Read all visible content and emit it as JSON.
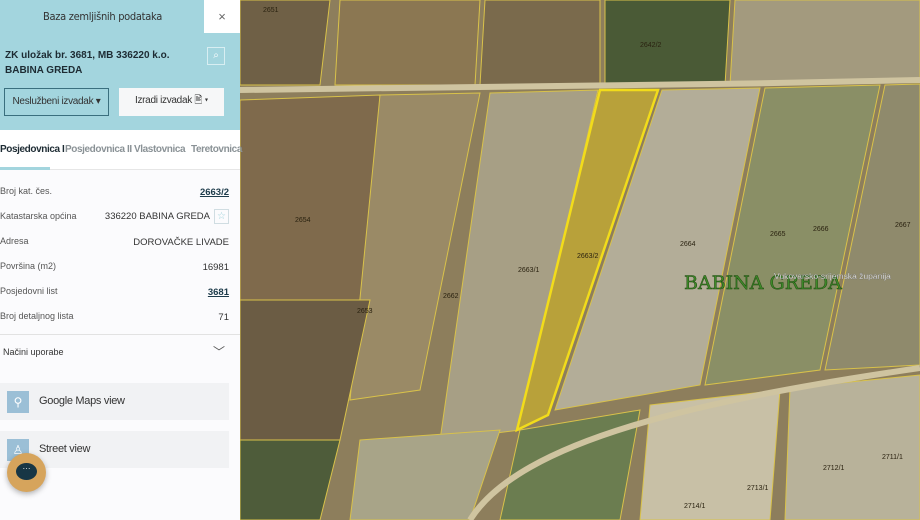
{
  "panel": {
    "title": "Baza zemljišnih podataka",
    "close": "×",
    "heading": "ZK uložak br. 3681, MB 336220 k.o. BABINA GREDA",
    "btn_unofficial": "Neslužbeni izvadak ▾",
    "btn_create": "Izradi izvadak 🖹 ▾",
    "tabs": [
      "Posjedovnica I",
      "Posjedovnica II",
      "Vlastovnica",
      "Teretovnica"
    ],
    "rows": [
      {
        "k": "Broj kat. čes.",
        "v": "2663/2"
      },
      {
        "k": "Katastarska općina",
        "v": "336220 BABINA GREDA"
      },
      {
        "k": "Adresa",
        "v": "DOROVAČKE LIVADE"
      },
      {
        "k": "Površina (m2)",
        "v": "16981"
      },
      {
        "k": "Posjedovni list",
        "v": "3681"
      },
      {
        "k": "Broj detaljnog lista",
        "v": "71"
      }
    ],
    "nacini": "Načini uporabe",
    "google": "Google Maps view",
    "street": "Street view"
  },
  "map": {
    "place": "BABINA GREDA",
    "county": "Vukovarsko-srijemska županija",
    "parcels": [
      "2651",
      "2642/2",
      "2654",
      "2653",
      "2662",
      "2663/1",
      "2663/2",
      "2664",
      "2665",
      "2666",
      "2667",
      "2714/1",
      "2713/1",
      "2712/1",
      "2711/1"
    ]
  },
  "colors": {
    "accent": "#a3d5de",
    "highlight": "#e8d21a",
    "chat": "#d6a45c"
  }
}
